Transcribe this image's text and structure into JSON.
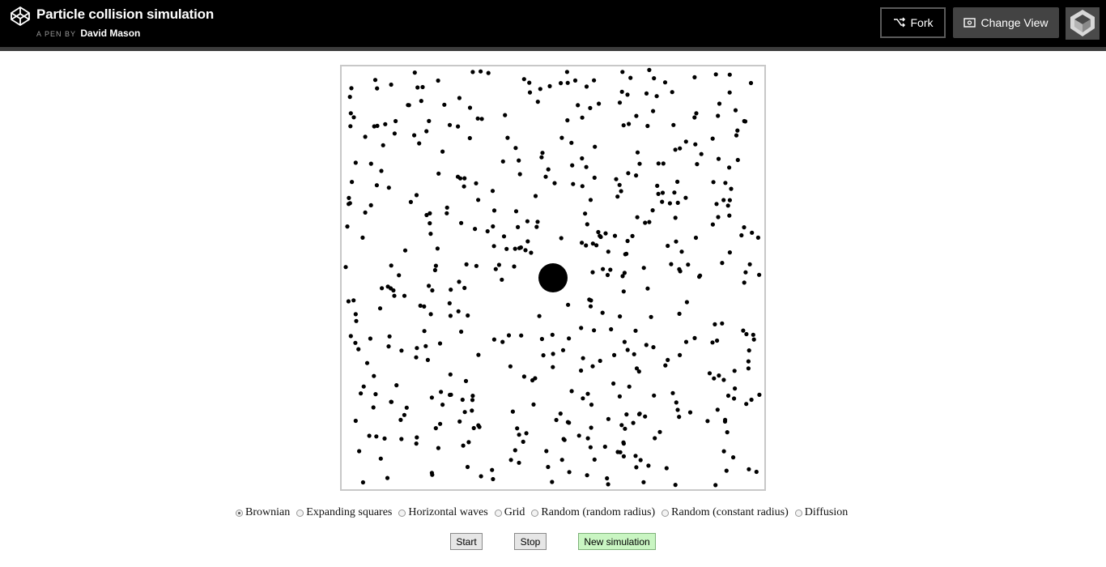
{
  "header": {
    "title": "Particle collision simulation",
    "byline_prefix": "A PEN BY",
    "author": "David Mason",
    "fork_label": "Fork",
    "change_view_label": "Change View"
  },
  "simulation": {
    "particle_count": 498,
    "large_particle_count": 1,
    "background": "#ffffff",
    "particle_color": "#000000"
  },
  "controls": {
    "modes": [
      {
        "label": "Brownian",
        "checked": true
      },
      {
        "label": "Expanding squares",
        "checked": false
      },
      {
        "label": "Horizontal waves",
        "checked": false
      },
      {
        "label": "Grid",
        "checked": false
      },
      {
        "label": "Random (random radius)",
        "checked": false
      },
      {
        "label": "Random (constant radius)",
        "checked": false
      },
      {
        "label": "Diffusion",
        "checked": false
      }
    ],
    "start_label": "Start",
    "stop_label": "Stop",
    "new_label": "New simulation"
  },
  "colors": {
    "header_bg": "#000000",
    "change_view_bg": "#434343",
    "new_sim_bg": "#c9f5c2"
  }
}
